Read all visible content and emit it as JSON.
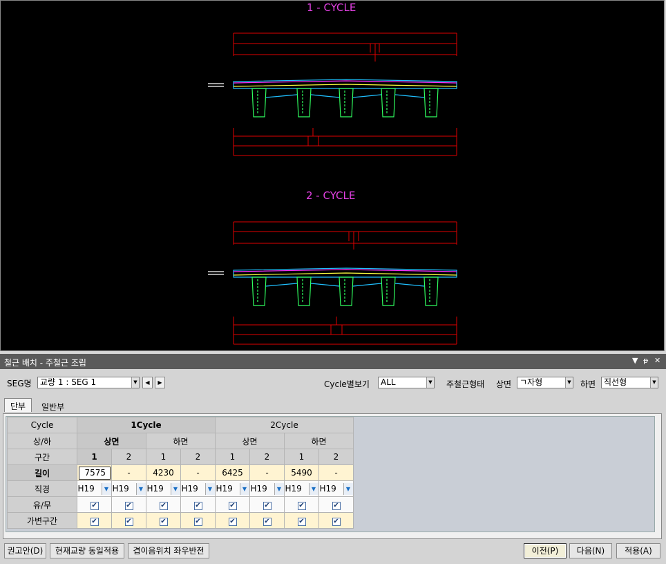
{
  "canvas": {
    "cycle1_title": "1 - CYCLE",
    "cycle2_title": "2 - CYCLE"
  },
  "panel": {
    "title": "철근 배치 - 주철근 조립",
    "seg_label": "SEG명",
    "seg_value": "교량 1 : SEG 1",
    "cycle_view_label": "Cycle별보기",
    "cycle_view_value": "ALL",
    "shape_label": "주철근형태",
    "top_label": "상면",
    "top_value": "ㄱ자형",
    "bottom_label": "하면",
    "bottom_value": "직선형",
    "tabs": [
      "단부",
      "일반부"
    ]
  },
  "grid": {
    "row_headers": [
      "Cycle",
      "상/하",
      "구간",
      "길이",
      "직경",
      "유/무",
      "가변구간"
    ],
    "cycles": [
      "1Cycle",
      "2Cycle"
    ],
    "faces": [
      "상면",
      "하면",
      "상면",
      "하면"
    ],
    "sections": [
      "1",
      "2",
      "1",
      "2",
      "1",
      "2",
      "1",
      "2"
    ],
    "lengths": [
      "7575",
      "-",
      "4230",
      "-",
      "6425",
      "-",
      "5490",
      "-"
    ],
    "diameters": [
      "H19",
      "H19",
      "H19",
      "H19",
      "H19",
      "H19",
      "H19",
      "H19"
    ],
    "exists": [
      true,
      true,
      true,
      true,
      true,
      true,
      true,
      true
    ],
    "variable": [
      true,
      true,
      true,
      true,
      true,
      true,
      true,
      true
    ]
  },
  "buttons": {
    "recommend": "권고안(D)",
    "same_apply": "현재교량 동일적용",
    "flip": "겹이음위치 좌우반전",
    "prev": "이전(P)",
    "next": "다음(N)",
    "apply": "적용(A)"
  }
}
